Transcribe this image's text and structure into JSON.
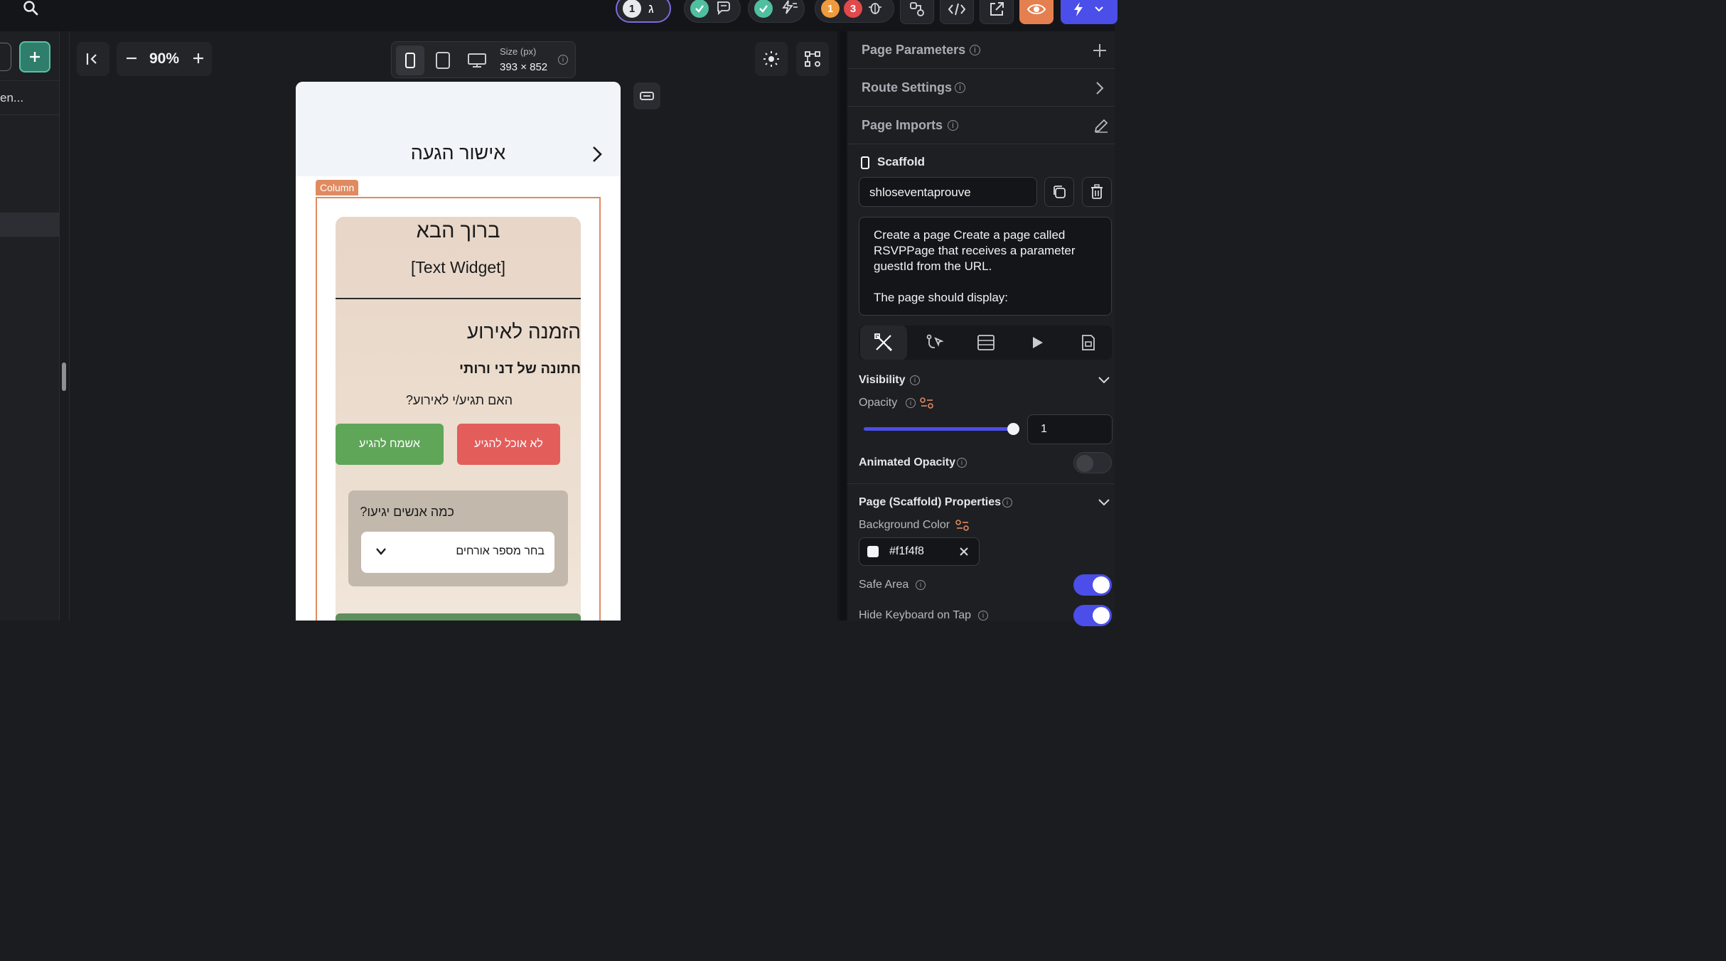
{
  "topbar": {
    "pill1_badge": "1",
    "pill1_glyph": "ג",
    "pill4_badge_a": "1",
    "pill4_badge_b": "3"
  },
  "left": {
    "item_label": "en..."
  },
  "canvas": {
    "zoom": "90%",
    "size_label": "Size (px)",
    "size_value": "393 × 852"
  },
  "phone": {
    "appbar_title": "אישור הגעה",
    "column_tag": "Column",
    "welcome": "ברוך הבא",
    "text_widget": "[Text Widget]",
    "invite": "הזמנה לאירוע",
    "wedding": "חתונה של דני ורותי",
    "question": "האם תגיע/י לאירוע?",
    "yes_button": "אשמח להגיע",
    "no_button": "לא אוכל להגיע",
    "guests_question": "כמה אנשים יגיעו?",
    "guests_placeholder": "בחר מספר אורחים"
  },
  "panel": {
    "page_parameters": "Page Parameters",
    "route_settings": "Route Settings",
    "page_imports": "Page Imports",
    "scaffold": "Scaffold",
    "page_name": "shloseventaprouve",
    "description_line1": "Create a page Create a page called RSVPPage that receives a parameter guestId from the URL.",
    "description_line2": "The page should display:",
    "visibility": "Visibility",
    "opacity": "Opacity",
    "opacity_value": "1",
    "animated_opacity": "Animated Opacity",
    "scaffold_props": "Page (Scaffold) Properties",
    "bg_color_label": "Background Color",
    "bg_color_value": "#f1f4f8",
    "safe_area": "Safe Area",
    "hide_keyboard": "Hide Keyboard on Tap"
  },
  "colors": {
    "accent": "#4b4ee8",
    "green_button": "#5fa659",
    "red_button": "#e35d5b",
    "selection": "#e08a60",
    "teal_add": "#3a9e86"
  }
}
